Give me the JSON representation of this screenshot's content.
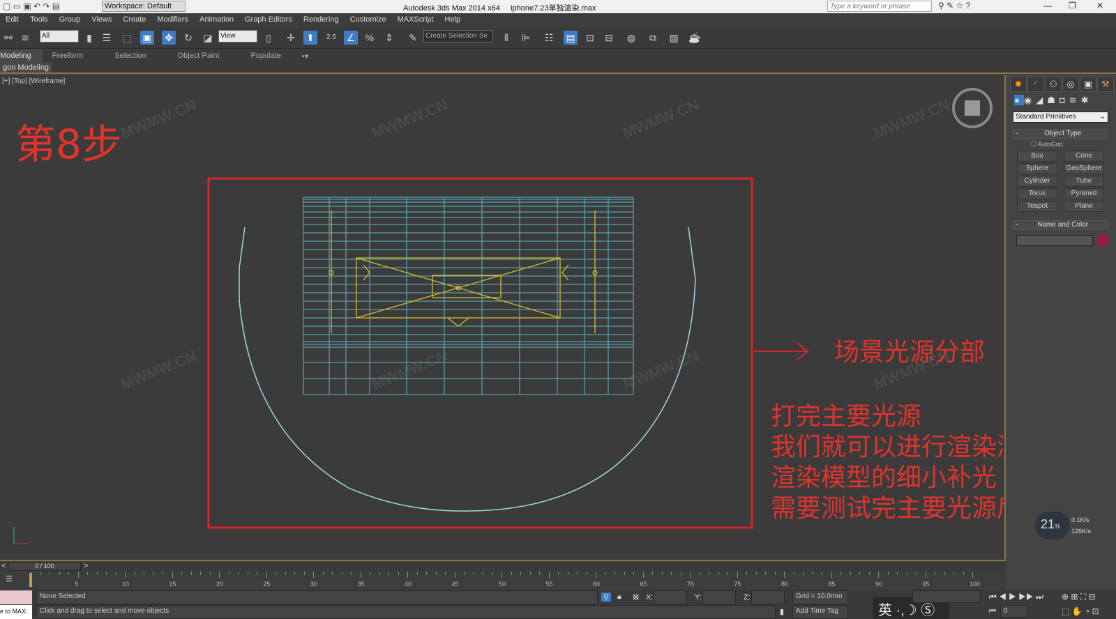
{
  "titlebar": {
    "workspace": "Workspace: Default",
    "app": "Autodesk 3ds Max  2014 x64",
    "file": "iphone7.23单独渲染.max",
    "search_placeholder": "Type a keyword or phrase"
  },
  "menu": [
    "Edit",
    "Tools",
    "Group",
    "Views",
    "Create",
    "Modifiers",
    "Animation",
    "Graph Editors",
    "Rendering",
    "Customize",
    "MAXScript",
    "Help"
  ],
  "toolbar": {
    "filter": "All",
    "refcoord": "View",
    "selset": "Create Selection Se",
    "snap_label": "2.5"
  },
  "ribbon": {
    "tabs": [
      "Modeling",
      "Freeform",
      "Selection",
      "Object Paint",
      "Populate"
    ],
    "sub": "gon Modeling"
  },
  "viewport": {
    "label": "[+] [Top] [Wireframe]",
    "watermark": "MWMW.CN"
  },
  "annotations": {
    "step": "第8步",
    "heading": "场景光源分部",
    "lines": [
      "打完主要光源",
      "我们就可以进行渲染测试了",
      "渲染模型的细小补光",
      "需要测试完主要光源后在调试"
    ],
    "accent": "#e0332c"
  },
  "panel": {
    "dropdown": "Standard Primitives",
    "object_type": "Object Type",
    "autogrid": "AutoGrid",
    "primitives": [
      "Box",
      "Cone",
      "Sphere",
      "GeoSphere",
      "Cylinder",
      "Tube",
      "Torus",
      "Pyramid",
      "Teapot",
      "Plane"
    ],
    "name_color": "Name and Color",
    "swatch": "#9a1b3c"
  },
  "timeline": {
    "frame": "0 / 100",
    "ticks": [
      "5",
      "10",
      "15",
      "20",
      "25",
      "30",
      "35",
      "40",
      "45",
      "50",
      "55",
      "60",
      "65",
      "70",
      "75",
      "80",
      "85",
      "90",
      "95",
      "100"
    ]
  },
  "status": {
    "selection": "None Selected",
    "prompt": "Click and drag to select and move objects",
    "grid": "Grid = 10.0mm",
    "time_tag": "Add Time Tag",
    "x": "X:",
    "y": "Y:",
    "z": "Z:",
    "script": "e to MAX:",
    "frame_field": "0",
    "ime": "英",
    "perf": "21",
    "perf_unit": "%",
    "net_up": "0.1K/s",
    "net_down": "126K/s"
  }
}
